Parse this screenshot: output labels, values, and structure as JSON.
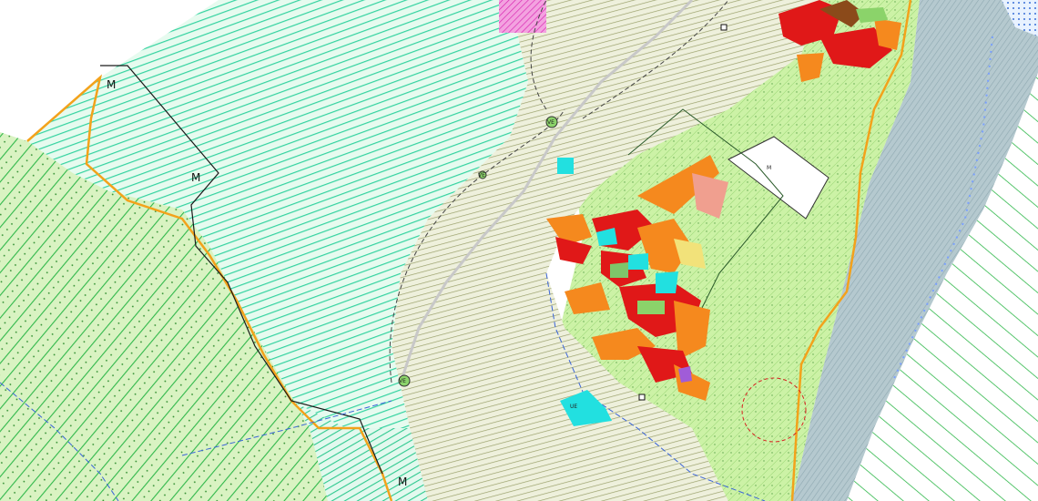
{
  "labels": {
    "m1": "M",
    "m2": "M",
    "m3": "M",
    "m4": "M",
    "v1": "VE",
    "v2": "VE",
    "v3": "VE",
    "ue": "UE"
  },
  "colors": {
    "forest_green": "#2fb84a",
    "meadow_cyan": "#34d3a0",
    "agri_olive": "#9aa06a",
    "light_green": "#ccf2a6",
    "river_gray": "#a9c0c8",
    "urban_red": "#e01818",
    "urban_orange": "#f5891e",
    "cyan": "#22e0e0",
    "magenta": "#f060c8",
    "municipal_boundary": "#f3a21b"
  }
}
